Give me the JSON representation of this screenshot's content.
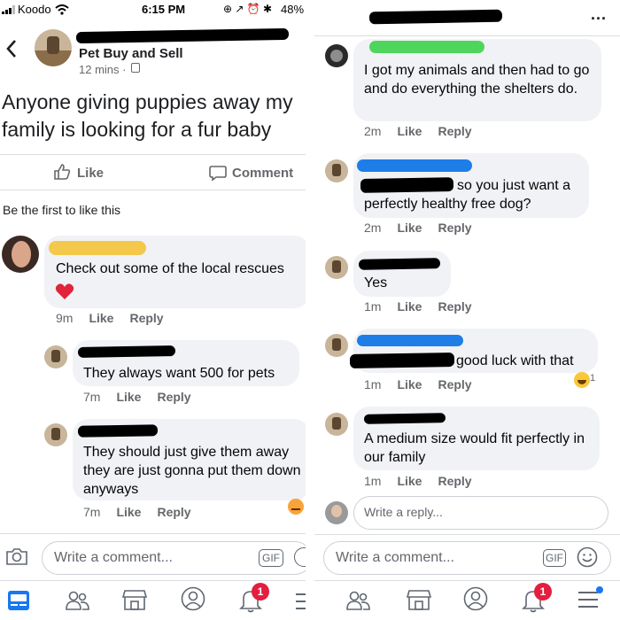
{
  "status_bar": {
    "carrier": "Koodo",
    "time": "6:15 PM",
    "battery": "48%"
  },
  "post": {
    "group_name": "Pet Buy and Sell",
    "time_ago": "12 mins ·",
    "text": "Anyone giving puppies away my family is looking for a fur baby",
    "like_label": "Like",
    "comment_label": "Comment",
    "first_like_text": "Be the first to like this"
  },
  "left_comments": [
    {
      "text": "Check out some of the local rescues",
      "time": "9m",
      "like": "Like",
      "reply": "Reply"
    },
    {
      "text": "They always want 500 for pets",
      "time": "7m",
      "like": "Like",
      "reply": "Reply"
    },
    {
      "text": "They should just give them away they are just gonna put them down anyways",
      "time": "7m",
      "like": "Like",
      "reply": "Reply"
    }
  ],
  "right_comments": [
    {
      "text": "I got my animals and then had to go and do everything the shelters do.",
      "time": "2m",
      "like": "Like",
      "reply": "Reply"
    },
    {
      "text": "so you just want a perfectly healthy free dog?",
      "time": "2m",
      "like": "Like",
      "reply": "Reply"
    },
    {
      "text": "Yes",
      "time": "1m",
      "like": "Like",
      "reply": "Reply"
    },
    {
      "text": "good luck with that",
      "time": "1m",
      "like": "Like",
      "reply": "Reply",
      "reaction_count": "1"
    },
    {
      "text": "A medium size would fit perfectly in our family",
      "time": "1m",
      "like": "Like",
      "reply": "Reply"
    }
  ],
  "reply_placeholder": "Write a reply...",
  "comment_placeholder": "Write a comment...",
  "gif_label": "GIF",
  "notification_badge": "1",
  "more_icon": "...",
  "colors": {
    "meta_gray": "#65676b",
    "bubble_bg": "#f0f2f5",
    "badge_red": "#e41e3f",
    "facebook_blue": "#1877f2"
  }
}
